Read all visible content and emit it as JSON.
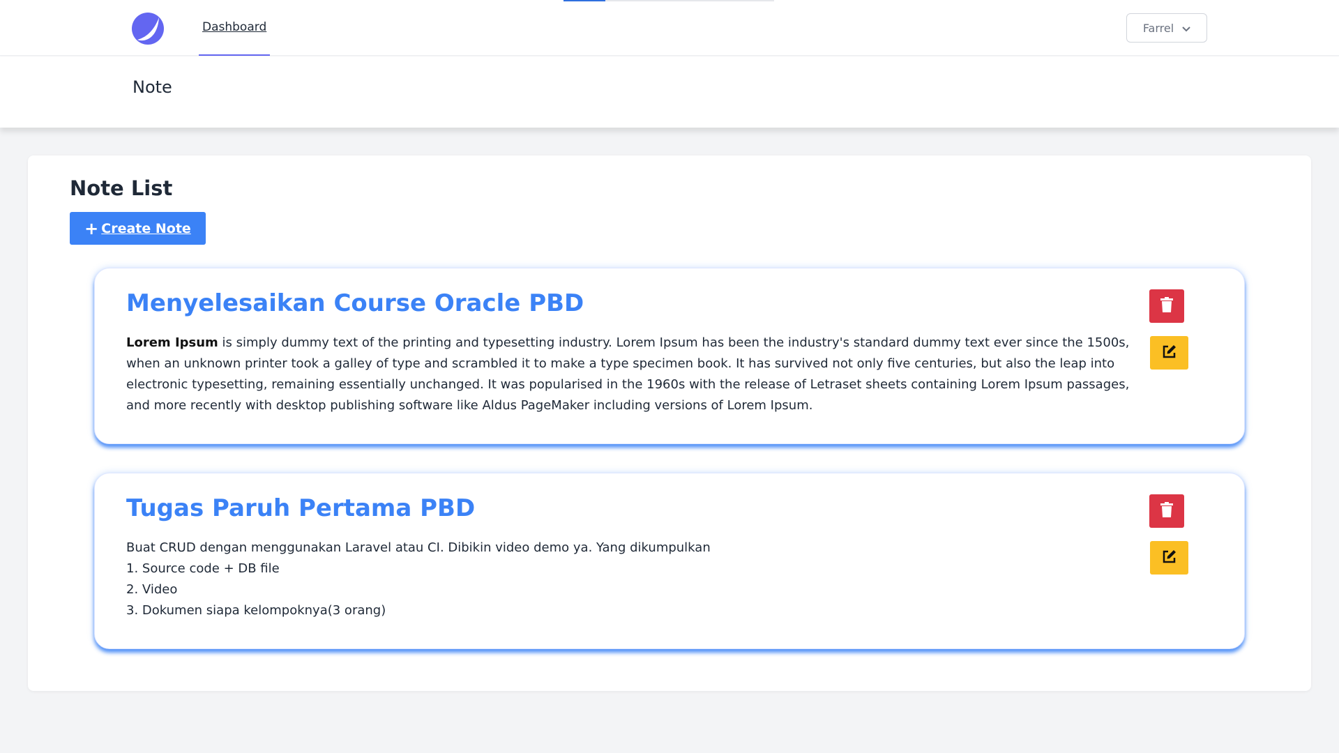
{
  "nav": {
    "dashboard_label": "Dashboard",
    "user_name": "Farrel",
    "load_progress": 0.2
  },
  "header": {
    "title": "Note"
  },
  "main": {
    "list_title": "Note List",
    "create_label": "Create Note"
  },
  "notes": [
    {
      "title": "Menyelesaikan Course Oracle PBD",
      "bold_lead": "Lorem Ipsum",
      "body": "is simply dummy text of the printing and typesetting industry. Lorem Ipsum has been the industry's standard dummy text ever since the 1500s, when an unknown printer took a galley of type and scrambled it to make a type specimen book. It has survived not only five centuries, but also the leap into electronic typesetting, remaining essentially unchanged. It was popularised in the 1960s with the release of Letraset sheets containing Lorem Ipsum passages, and more recently with desktop publishing software like Aldus PageMaker including versions of Lorem Ipsum."
    },
    {
      "title": "Tugas Paruh Pertama PBD",
      "lines": [
        "Buat CRUD dengan menggunakan Laravel atau CI. Dibikin video demo ya. Yang dikumpulkan",
        "1. Source code + DB file",
        "2. Video",
        "3. Dokumen siapa kelompoknya(3 orang)"
      ]
    }
  ],
  "icons": {
    "logo": "logo-icon",
    "user_menu": "chevron-down-icon",
    "create": "plus-icon",
    "delete": "trash-icon",
    "edit": "edit-icon"
  },
  "colors": {
    "primary": "#3b82f6",
    "danger": "#dc3545",
    "warning": "#fbbf24",
    "accent": "#6366f1"
  }
}
